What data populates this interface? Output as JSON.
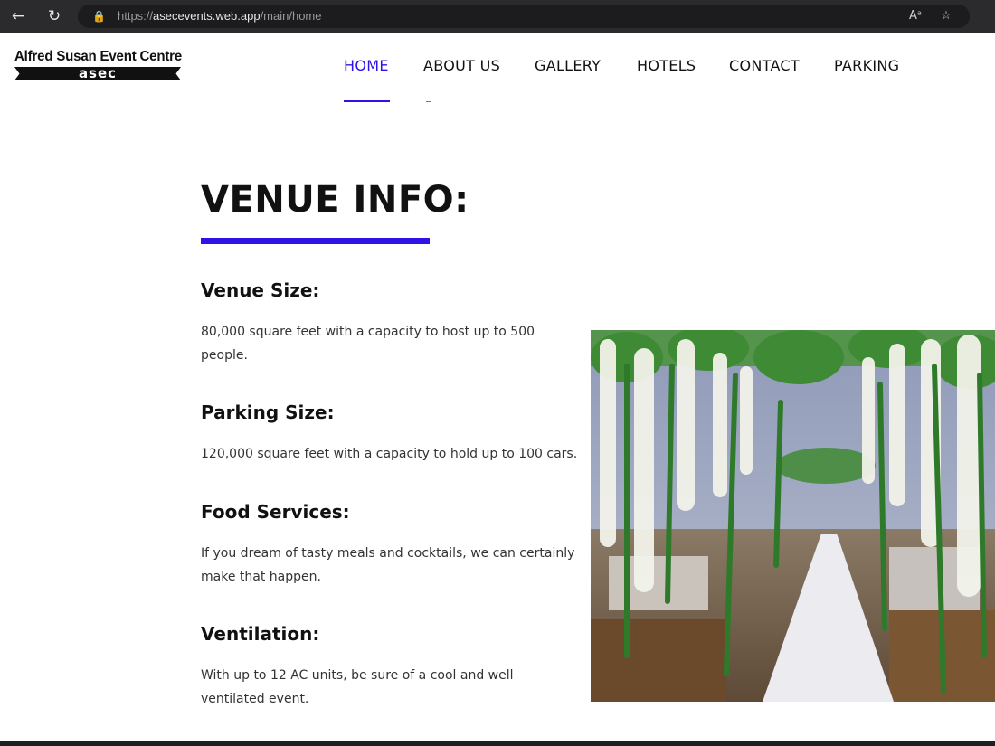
{
  "browser": {
    "url_prefix": "https://",
    "url_host": "asecevents.web.app",
    "url_path": "/main/home"
  },
  "logo": {
    "title": "Alfred Susan Event Centre",
    "abbr": "asec"
  },
  "nav": {
    "items": [
      {
        "label": "HOME",
        "active": true
      },
      {
        "label": "ABOUT US",
        "active": false
      },
      {
        "label": "GALLERY",
        "active": false
      },
      {
        "label": "HOTELS",
        "active": false
      },
      {
        "label": "CONTACT",
        "active": false
      },
      {
        "label": "PARKING",
        "active": false
      }
    ]
  },
  "main": {
    "heading": "VENUE INFO:",
    "sections": [
      {
        "title": "Venue Size:",
        "text": "80,000 square feet with a capacity to host up to 500 people."
      },
      {
        "title": "Parking Size:",
        "text": "120,000 square feet with a capacity to hold up to 100 cars."
      },
      {
        "title": "Food Services:",
        "text": "If you dream of tasty meals and cocktails, we can certainly make that happen."
      },
      {
        "title": "Ventilation:",
        "text": "With up to 12 AC units, be sure of a cool and well ventilated event."
      }
    ]
  },
  "colors": {
    "accent": "#2f12e6",
    "text": "#111111"
  },
  "icons": [
    "back-arrow-icon",
    "reload-icon",
    "lock-icon",
    "read-aloud-icon",
    "favorite-star-icon"
  ]
}
